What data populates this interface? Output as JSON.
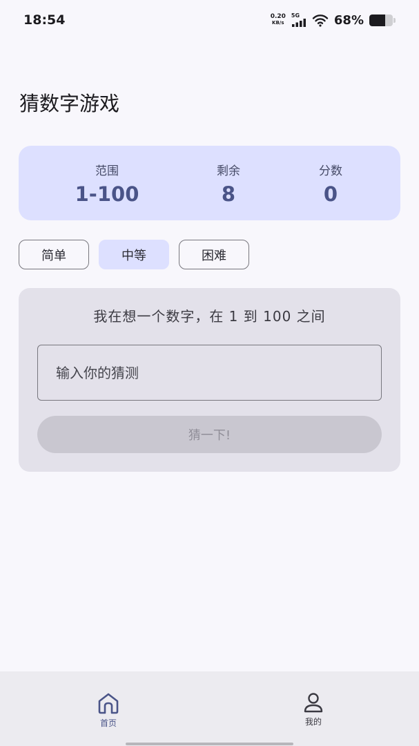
{
  "status_bar": {
    "time": "18:54",
    "net_speed_value": "0.20",
    "net_speed_unit": "KB/s",
    "network_type": "5G",
    "battery_percent": "68%",
    "battery_level": 0.68
  },
  "header": {
    "title": "猜数字游戏"
  },
  "stats": {
    "range_label": "范围",
    "range_value": "1-100",
    "remaining_label": "剩余",
    "remaining_value": "8",
    "score_label": "分数",
    "score_value": "0"
  },
  "difficulty": {
    "easy": "简单",
    "medium": "中等",
    "hard": "困难",
    "selected": "medium"
  },
  "game": {
    "prompt": "我在想一个数字，在 1 到 100 之间",
    "input_placeholder": "输入你的猜测",
    "input_value": "",
    "guess_button": "猜一下!"
  },
  "nav": {
    "home": "首页",
    "mine": "我的",
    "active": "home"
  },
  "colors": {
    "accent": "#4a5488",
    "stats_bg": "#dde0ff",
    "card_bg": "#e3e1ea",
    "nav_active": "#4a5488",
    "nav_inactive": "#3b3a42"
  },
  "icons": {
    "wifi": "wifi-icon",
    "signal": "signal-icon",
    "battery": "battery-icon",
    "home": "home-icon",
    "person": "person-icon"
  }
}
